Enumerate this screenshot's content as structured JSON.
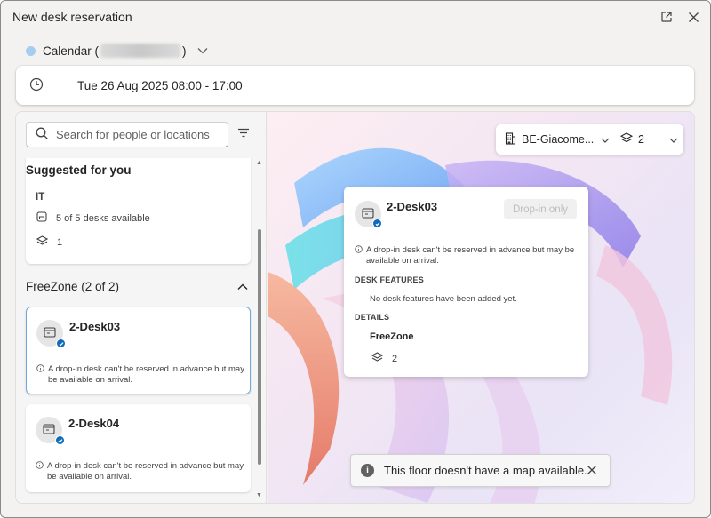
{
  "window": {
    "title": "New desk reservation"
  },
  "calendar": {
    "label_prefix": "Calendar (",
    "label_suffix": ")",
    "dot_color": "#a6cdf1"
  },
  "datetime": {
    "text": "Tue 26 Aug 2025 08:00 - 17:00"
  },
  "search": {
    "placeholder": "Search for people or locations"
  },
  "suggested": {
    "heading": "Suggested for you",
    "department": "IT",
    "desks_available": "5 of 5 desks available",
    "floor": "1"
  },
  "group": {
    "title": "FreeZone (2 of 2)",
    "desks": [
      {
        "name": "2-Desk03",
        "note": "A drop-in desk can't be reserved in advance but may be available on arrival."
      },
      {
        "name": "2-Desk04",
        "note": "A drop-in desk can't be reserved in advance but may be available on arrival."
      }
    ]
  },
  "map_selector": {
    "building": "BE-Giacome...",
    "floor": "2"
  },
  "detail": {
    "name": "2-Desk03",
    "dropin_label": "Drop-in only",
    "note": "A drop-in desk can't be reserved in advance but may be available on arrival.",
    "features_heading": "DESK FEATURES",
    "features_text": "No desk features have been added yet.",
    "details_heading": "DETAILS",
    "zone": "FreeZone",
    "floor": "2"
  },
  "toast": {
    "message": "This floor doesn't have a map available."
  },
  "colors": {
    "accent": "#0f6cbd",
    "selected_border": "#6fa8dc"
  }
}
